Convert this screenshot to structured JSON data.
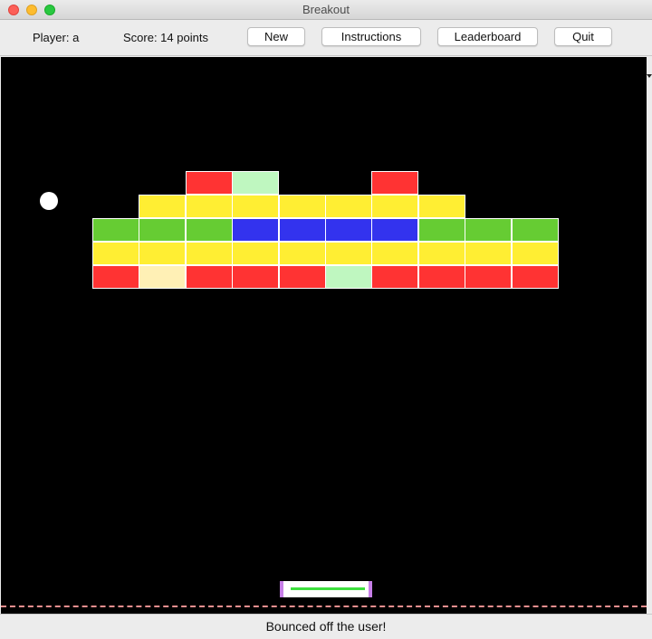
{
  "window": {
    "title": "Breakout"
  },
  "toolbar": {
    "player": "Player: a",
    "score": "Score: 14 points",
    "new_label": "New",
    "instructions_label": "Instructions",
    "leaderboard_label": "Leaderboard",
    "quit_label": "Quit"
  },
  "status": "Bounced off the user!",
  "colors": {
    "red": "#ff3333",
    "yellow": "#ffee33",
    "green": "#66cc33",
    "blue": "#3333ee",
    "light_green": "#bff7c0",
    "cream": "#fff0b5",
    "empty": null
  },
  "bricks": {
    "columns": 10,
    "rows": [
      [
        "empty",
        "empty",
        "red",
        "light_green",
        "empty",
        "empty",
        "red",
        "empty",
        "empty",
        "empty"
      ],
      [
        "empty",
        "yellow",
        "yellow",
        "yellow",
        "yellow",
        "yellow",
        "yellow",
        "yellow",
        "empty",
        "empty"
      ],
      [
        "green",
        "green",
        "green",
        "blue",
        "blue",
        "blue",
        "blue",
        "green",
        "green",
        "green"
      ],
      [
        "yellow",
        "yellow",
        "yellow",
        "yellow",
        "yellow",
        "yellow",
        "yellow",
        "yellow",
        "yellow",
        "yellow"
      ],
      [
        "red",
        "cream",
        "red",
        "red",
        "red",
        "light_green",
        "red",
        "red",
        "red",
        "red"
      ]
    ]
  }
}
